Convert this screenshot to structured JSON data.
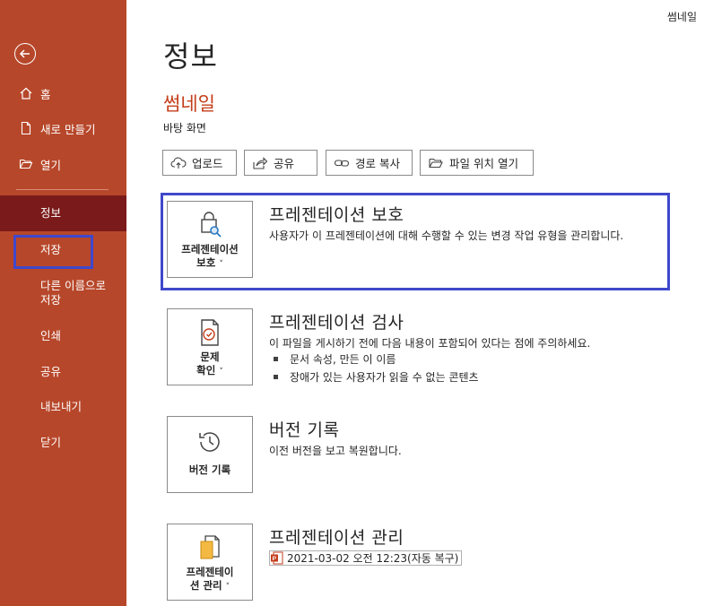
{
  "header": {
    "file_name": "썸네일"
  },
  "sidebar": {
    "items": [
      {
        "label": "홈"
      },
      {
        "label": "새로 만들기"
      },
      {
        "label": "열기"
      },
      {
        "label": "정보"
      },
      {
        "label": "저장"
      },
      {
        "label": "다른 이름으로 저장"
      },
      {
        "label": "인쇄"
      },
      {
        "label": "공유"
      },
      {
        "label": "내보내기"
      },
      {
        "label": "닫기"
      }
    ],
    "save_as_line1": "다른 이름으로",
    "save_as_line2": "저장"
  },
  "main": {
    "title": "정보",
    "doc_title": "썸네일",
    "doc_location": "바탕 화면",
    "toolbar": {
      "upload": "업로드",
      "share": "공유",
      "copy_path": "경로 복사",
      "open_location": "파일 위치 열기"
    },
    "sections": {
      "protect": {
        "button_line1": "프레젠테이션",
        "button_line2": "보호",
        "title": "프레젠테이션 보호",
        "desc": "사용자가 이 프레젠테이션에 대해 수행할 수 있는 변경 작업 유형을 관리합니다."
      },
      "inspect": {
        "button_line1": "문제",
        "button_line2": "확인",
        "title": "프레젠테이션 검사",
        "desc": "이 파일을 게시하기 전에 다음 내용이 포함되어 있다는 점에 주의하세요.",
        "bullets": [
          "문서 속성, 만든 이 이름",
          "장애가 있는 사용자가 읽을 수 없는 콘텐츠"
        ]
      },
      "history": {
        "button_label": "버전 기록",
        "title": "버전 기록",
        "desc": "이전 버전을 보고 복원합니다."
      },
      "manage": {
        "button_line1": "프레젠테이",
        "button_line2": "션 관리",
        "title": "프레젠테이션 관리",
        "version_entry": "2021-03-02 오전 12:23(자동 복구)"
      }
    },
    "chevron": "˅"
  },
  "colors": {
    "sidebar_bg": "#b7472a",
    "sidebar_active": "#7b1a1a",
    "accent_title": "#c43e1c",
    "highlight_border": "#3f48cc"
  }
}
